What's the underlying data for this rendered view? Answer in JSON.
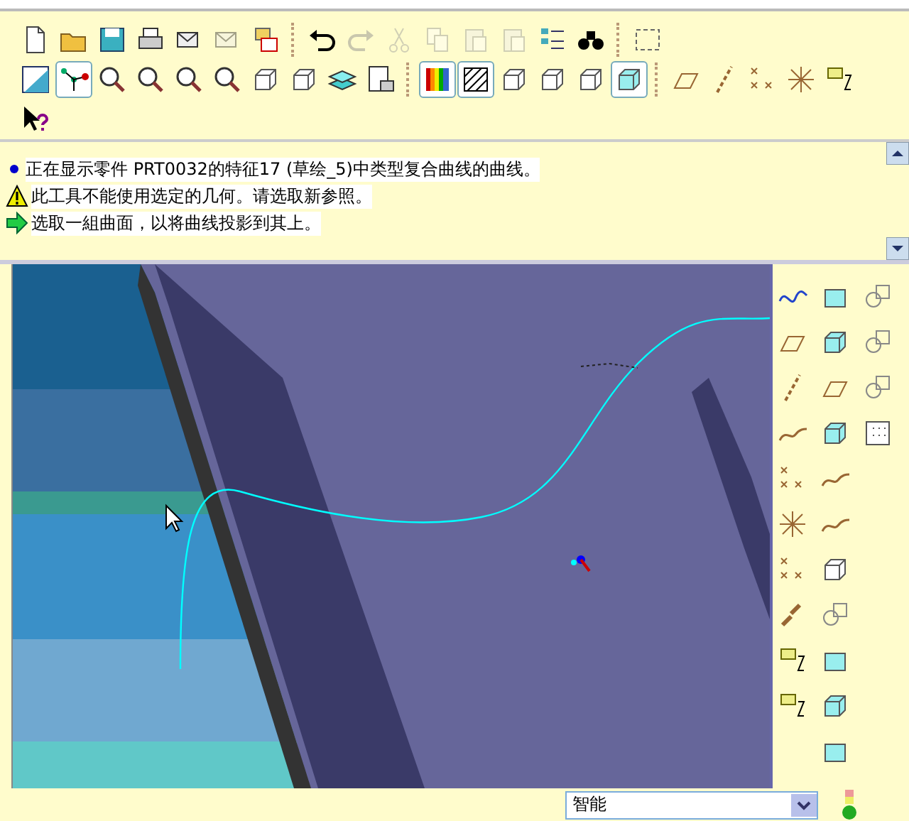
{
  "toolbar": {
    "rows": [
      [
        {
          "on": false,
          "disabled": false
        },
        {
          "on": false,
          "disabled": false
        },
        {
          "on": false,
          "disabled": false
        },
        {
          "on": false,
          "disabled": false
        },
        {
          "on": false,
          "disabled": false
        },
        {
          "on": false,
          "disabled": true
        },
        {
          "on": false,
          "disabled": false
        },
        {
          "on": false,
          "disabled": false
        },
        {
          "on": false,
          "disabled": true
        },
        {
          "on": false,
          "disabled": true
        },
        {
          "on": false,
          "disabled": true
        },
        {
          "on": false,
          "disabled": true
        },
        {
          "on": false,
          "disabled": true
        },
        {
          "on": false,
          "disabled": false
        },
        {
          "on": false,
          "disabled": false
        },
        {
          "on": false,
          "disabled": false
        }
      ],
      [
        {
          "on": false,
          "disabled": false
        },
        {
          "on": true,
          "disabled": false
        },
        {
          "on": false,
          "disabled": false
        },
        {
          "on": false,
          "disabled": false
        },
        {
          "on": false,
          "disabled": false
        },
        {
          "on": false,
          "disabled": false
        },
        {
          "on": false,
          "disabled": false
        },
        {
          "on": false,
          "disabled": false
        },
        {
          "on": false,
          "disabled": false
        },
        {
          "on": false,
          "disabled": false
        },
        {
          "on": true,
          "disabled": false
        },
        {
          "on": true,
          "disabled": false
        },
        {
          "on": false,
          "disabled": false
        },
        {
          "on": false,
          "disabled": false
        },
        {
          "on": false,
          "disabled": false
        },
        {
          "on": true,
          "disabled": false
        },
        {
          "on": false,
          "disabled": false
        },
        {
          "on": false,
          "disabled": false
        },
        {
          "on": false,
          "disabled": false
        },
        {
          "on": false,
          "disabled": false
        },
        {
          "on": false,
          "disabled": false
        }
      ],
      [
        {
          "on": false,
          "disabled": false
        }
      ]
    ]
  },
  "messages": [
    {
      "kind": "info",
      "text": "正在显示零件 PRT0032的特征17 (草绘_5)中类型复合曲线的曲线。"
    },
    {
      "kind": "warning",
      "text": "此工具不能使用选定的几何。请选取新参照。"
    },
    {
      "kind": "prompt",
      "text": "选取一組曲面，以将曲线投影到其上。"
    }
  ],
  "status_bar": {
    "filter": {
      "value": "智能"
    }
  }
}
